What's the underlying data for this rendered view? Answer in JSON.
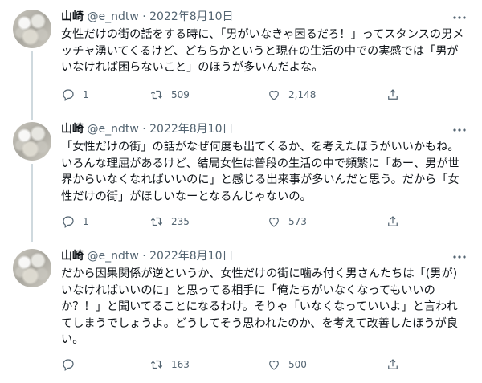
{
  "tweets": [
    {
      "author": "山崎",
      "handle": "@e_ndtw",
      "dot": "·",
      "date": "2022年8月10日",
      "text": "女性だけの街の話をする時に、「男がいなきゃ困るだろ！」ってスタンスの男メッチャ湧いてくるけど、どちらかというと現在の生活の中での実感では「男がいなければ困らないこと」のほうが多いんだよな。",
      "replies": "1",
      "retweets": "509",
      "likes": "2,148"
    },
    {
      "author": "山崎",
      "handle": "@e_ndtw",
      "dot": "·",
      "date": "2022年8月10日",
      "text": "「女性だけの街」の話がなぜ何度も出てくるか、を考えたほうがいいかもね。いろんな理屈があるけど、結局女性は普段の生活の中で頻繁に「あー、男が世界からいなくなればいいのに」と感じる出来事が多いんだと思う。だから「女性だけの街」がほしいなーとなるんじゃないの。",
      "replies": "1",
      "retweets": "235",
      "likes": "573"
    },
    {
      "author": "山崎",
      "handle": "@e_ndtw",
      "dot": "·",
      "date": "2022年8月10日",
      "text": "だから因果関係が逆というか、女性だけの街に噛み付く男さんたちは「(男が)いなければいいのに」と思ってる相手に「俺たちがいなくなってもいいのか？！」と聞いてることになるわけ。そりゃ「いなくなっていいよ」と言われてしまうでしょうよ。どうしてそう思われたのか、を考えて改善したほうが良い。",
      "replies": "",
      "retweets": "163",
      "likes": "500"
    }
  ],
  "icons": {
    "avatar": "cloud-photo-avatar",
    "more": "more-horizontal-icon",
    "reply": "reply-icon",
    "retweet": "retweet-icon",
    "like": "heart-icon",
    "share": "share-icon"
  },
  "colors": {
    "text": "#0f1419",
    "secondary": "#536471",
    "thread_line": "#cfd9de",
    "divider": "#eff3f4",
    "background": "#ffffff"
  }
}
